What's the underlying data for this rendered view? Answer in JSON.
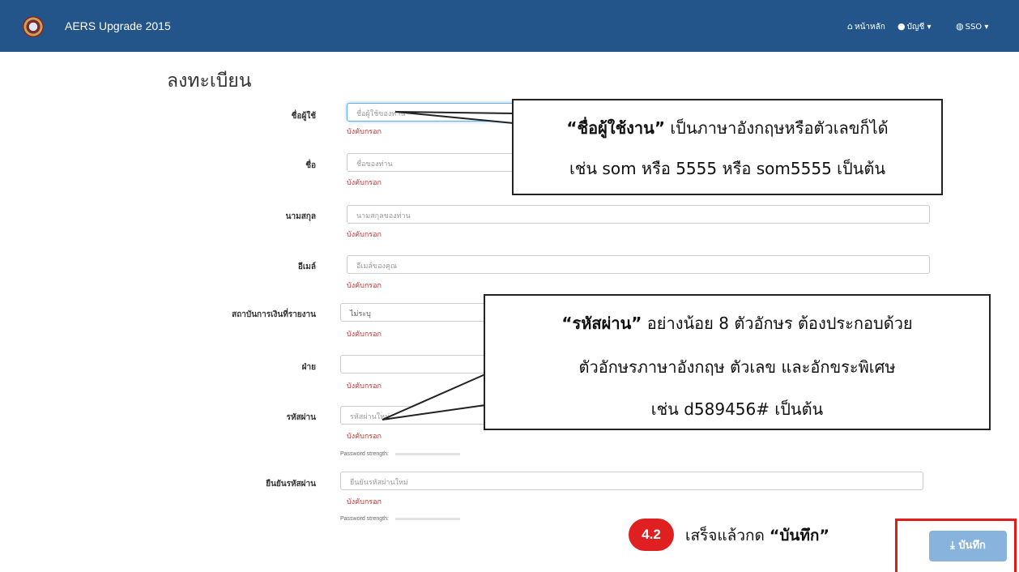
{
  "navbar": {
    "brand": "AERS Upgrade 2015",
    "home_icon": "home-icon",
    "home_label": "หน้าหลัก",
    "account_icon": "user-icon",
    "account_label": "บัญชี ▾",
    "sso_icon": "globe-icon",
    "sso_label": "SSO ▾"
  },
  "page": {
    "title": "ลงทะเบียน"
  },
  "form": {
    "required_text": "บังคับกรอก",
    "password_strength_label": "Password strength:",
    "fields": {
      "username": {
        "label": "ชื่อผู้ใช้",
        "placeholder": "ชื่อผู้ใช้ของท่าน"
      },
      "firstname": {
        "label": "ชื่อ",
        "placeholder": "ชื่อของท่าน"
      },
      "lastname": {
        "label": "นามสกุล",
        "placeholder": "นามสกุลของท่าน"
      },
      "email": {
        "label": "อีเมล์",
        "placeholder": "อีเมล์ของคุณ"
      },
      "institution": {
        "label": "สถาบันการเงินที่รายงาน",
        "value": "ไม่ระบุ"
      },
      "department": {
        "label": "ฝ่าย",
        "placeholder": ""
      },
      "password": {
        "label": "รหัสผ่าน",
        "placeholder": "รหัสผ่านใหม่"
      },
      "confirm_password": {
        "label": "ยืนยันรหัสผ่าน",
        "placeholder": "ยืนยันรหัสผ่านใหม่"
      }
    }
  },
  "callouts": {
    "username_note": {
      "line1_bold": "“ชื่อผู้ใช้งาน”",
      "line1_rest": " เป็นภาษาอังกฤษหรือตัวเลขก็ได้",
      "line2": "เช่น som หรือ 5555 หรือ som5555 เป็นต้น"
    },
    "password_note": {
      "line1_bold": "“รหัสผ่าน”",
      "line1_rest": " อย่างน้อย 8 ตัวอักษร ต้องประกอบด้วย",
      "line2": "ตัวอักษรภาษาอังกฤษ ตัวเลข และอักขระพิเศษ",
      "line3": "เช่น d589456# เป็นต้น"
    }
  },
  "step": {
    "badge": "4.2",
    "text_prefix": "เสร็จแล้วกด ",
    "text_bold": "“บันทึก”"
  },
  "save_button": {
    "icon": "download-icon",
    "label": "บันทึก"
  },
  "colors": {
    "navbar": "#23558a",
    "required": "#c9302c",
    "badge": "#e02020",
    "save_button": "#87b3dc",
    "highlight": "#e21b1b"
  }
}
